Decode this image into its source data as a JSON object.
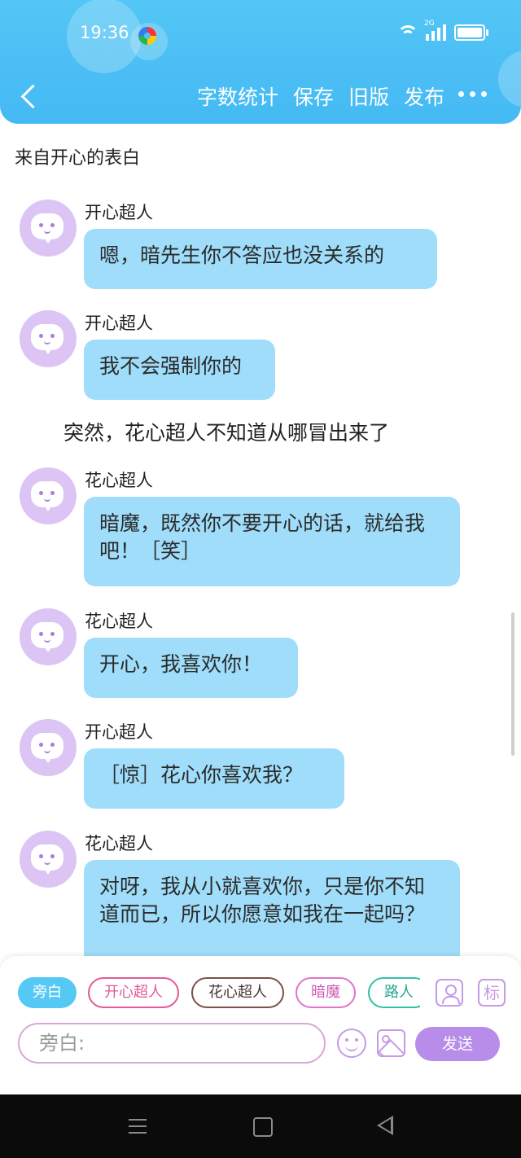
{
  "status_bar": {
    "time": "19:36",
    "network_label": "2G",
    "icons": [
      "browser-logo-icon",
      "wifi-icon",
      "signal-icon",
      "battery-icon"
    ]
  },
  "header": {
    "back_icon": "chevron-left-icon",
    "actions": [
      "字数统计",
      "保存",
      "旧版",
      "发布"
    ],
    "more_icon": "more-dots-icon",
    "accent_color": "#4bbff4"
  },
  "document": {
    "title": "来自开心的表白"
  },
  "messages": [
    {
      "sender": "开心超人",
      "text": "嗯，暗先生你不答应也没关系的"
    },
    {
      "sender": "开心超人",
      "text": "我不会强制你的"
    },
    {
      "sender": "花心超人",
      "text": "暗魔，既然你不要开心的话，就给我吧！［笑］"
    },
    {
      "sender": "花心超人",
      "text": "开心，我喜欢你！"
    },
    {
      "sender": "开心超人",
      "text": "［惊］花心你喜欢我？"
    },
    {
      "sender": "花心超人",
      "text": "对呀，我从小就喜欢你，只是你不知道而已，所以你愿意如我在一起吗？"
    }
  ],
  "narration": "突然，花心超人不知道从哪冒出来了",
  "composer": {
    "roles": [
      "旁白",
      "开心超人",
      "花心超人",
      "暗魔",
      "路人"
    ],
    "selected_role": "旁白",
    "input_placeholder": "旁白:",
    "tag_label": "标",
    "send_label": "发送",
    "bubble_color": "#9fddfa",
    "send_color": "#b88ce9"
  }
}
